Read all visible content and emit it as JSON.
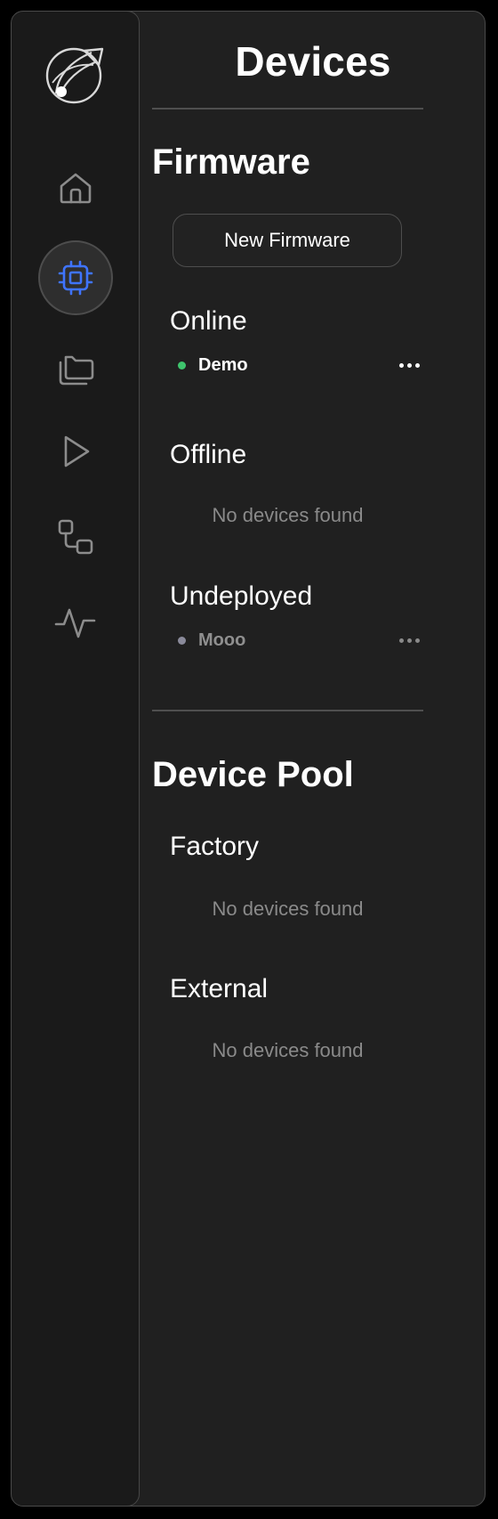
{
  "header": {
    "title": "Devices"
  },
  "sidebar": {
    "logo": "telescope-logo-icon",
    "items": [
      {
        "icon": "home-icon",
        "active": false
      },
      {
        "icon": "cpu-chip-icon",
        "active": true
      },
      {
        "icon": "folders-icon",
        "active": false
      },
      {
        "icon": "play-icon",
        "active": false
      },
      {
        "icon": "workflow-icon",
        "active": false
      },
      {
        "icon": "activity-icon",
        "active": false
      }
    ]
  },
  "firmware": {
    "title": "Firmware",
    "new_button": "New Firmware",
    "online": {
      "label": "Online",
      "devices": [
        {
          "name": "Demo",
          "status_color": "#3ec46d"
        }
      ]
    },
    "offline": {
      "label": "Offline",
      "empty": "No devices found"
    },
    "undeployed": {
      "label": "Undeployed",
      "devices": [
        {
          "name": "Mooo",
          "status_color": "#8a8a9a"
        }
      ]
    }
  },
  "pool": {
    "title": "Device Pool",
    "factory": {
      "label": "Factory",
      "empty": "No devices found"
    },
    "external": {
      "label": "External",
      "empty": "No devices found"
    }
  }
}
